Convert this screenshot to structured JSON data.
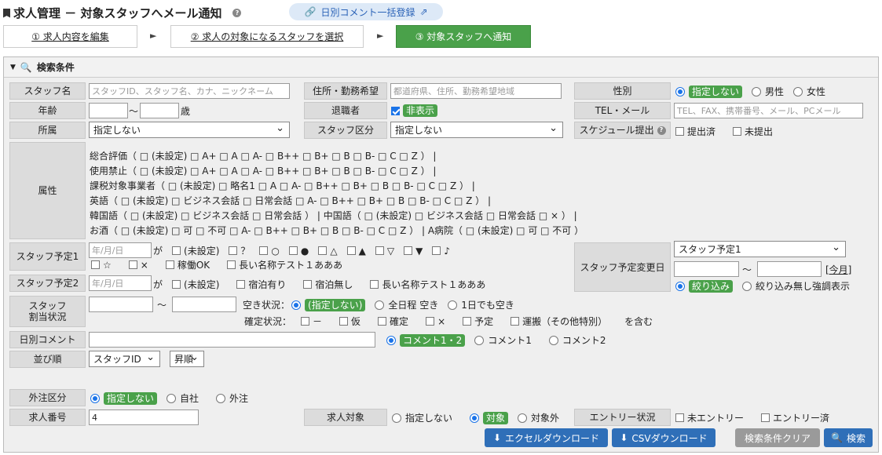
{
  "header": {
    "title": "求人管理 － 対象スタッフへメール通知",
    "bulk_comment": "日別コメント一括登録"
  },
  "steps": [
    {
      "label": "① 求人内容を編集"
    },
    {
      "label": "② 求人の対象になるスタッフを選択"
    },
    {
      "label": "③ 対象スタッフへ通知"
    }
  ],
  "panel": {
    "title": "検索条件"
  },
  "staff_name": {
    "label": "スタッフ名",
    "placeholder": "スタッフID、スタッフ名、カナ、ニックネーム"
  },
  "address": {
    "label": "住所・勤務希望",
    "placeholder": "都道府県、住所、勤務希望地域"
  },
  "gender": {
    "label": "性別",
    "options": [
      "指定しない",
      "男性",
      "女性"
    ]
  },
  "age": {
    "label": "年齢",
    "tilde": "～",
    "unit": "歳"
  },
  "retired": {
    "label": "退職者",
    "option": "非表示"
  },
  "tel": {
    "label": "TEL・メール",
    "placeholder": "TEL、FAX、携帯番号、メール、PCメール"
  },
  "affiliation": {
    "label": "所属",
    "value": "指定しない"
  },
  "staff_class": {
    "label": "スタッフ区分",
    "value": "指定しない"
  },
  "schedule": {
    "label": "スケジュール提出",
    "options": [
      "提出済",
      "未提出"
    ]
  },
  "attributes": {
    "label": "属性",
    "rows": [
      "総合評価（ □ (未設定) □ A+ □ A □ A- □ B++ □ B+ □ B □ B- □ C □ Z ） |",
      "使用禁止（ □ (未設定) □ A+ □ A □ A- □ B++ □ B+ □ B □ B- □ C □ Z ） |",
      "課税対象事業者（ □ (未設定) □ 略名1 □ A □ A- □ B++ □ B+ □ B □ B- □ C □ Z ） |",
      "英語（ □ (未設定) □ ビジネス会話 □ 日常会話 □ A- □ B++ □ B+ □ B □ B- □ C □ Z ） |",
      "韓国語（ □ (未設定) □ ビジネス会話 □ 日常会話 ） | 中国語（ □ (未設定) □ ビジネス会話 □ 日常会話 □ × ） |",
      "お酒（ □ (未設定) □ 可 □ 不可 □ A- □ B++ □ B+ □ B □ B- □ C □ Z ） | A病院（ □ (未設定) □ 可 □ 不可 ）"
    ]
  },
  "schedule1": {
    "label": "スタッフ予定1",
    "placeholder": "年/月/日",
    "ga": "が",
    "row1": [
      "(未設定)",
      "？",
      "○",
      "●",
      "△",
      "▲",
      "▽",
      "▼",
      "♪"
    ],
    "row2": [
      "☆",
      "×",
      "稼働OK",
      "長い名称テスト１あああ"
    ]
  },
  "schedule2": {
    "label": "スタッフ予定2",
    "placeholder": "年/月/日",
    "ga": "が",
    "options": [
      "(未設定)",
      "宿泊有り",
      "宿泊無し",
      "長い名称テスト１あああ"
    ]
  },
  "schedule_change": {
    "label": "スタッフ予定変更日",
    "select": "スタッフ予定1",
    "tilde": "～",
    "today": "[今月]",
    "options": [
      "絞り込み",
      "絞り込み無し強調表示"
    ]
  },
  "assign": {
    "label": "スタッフ\n割当状況",
    "tilde": "～",
    "vacancy_label": "空き状況：",
    "vacancy": [
      "(指定しない)",
      "全日程 空き",
      "1日でも空き"
    ],
    "confirm_label": "確定状況：",
    "confirm": [
      "－",
      "仮",
      "確定",
      "×",
      "予定",
      "運搬（その他特別）"
    ],
    "suffix": "を含む"
  },
  "daily_comment": {
    "label": "日別コメント",
    "options": [
      "コメント1・2",
      "コメント1",
      "コメント2"
    ]
  },
  "sort": {
    "label": "並び順",
    "field": "スタッフID",
    "order": "昇順"
  },
  "outsource": {
    "label": "外注区分",
    "options": [
      "指定しない",
      "自社",
      "外注"
    ]
  },
  "job_no": {
    "label": "求人番号",
    "value": "4"
  },
  "job_target": {
    "label": "求人対象",
    "options": [
      "指定しない",
      "対象",
      "対象外"
    ]
  },
  "entry": {
    "label": "エントリー状況",
    "options": [
      "未エントリー",
      "エントリー済"
    ]
  },
  "buttons": {
    "excel": "エクセルダウンロード",
    "csv": "CSVダウンロード",
    "clear": "検索条件クリア",
    "search": "検索"
  }
}
